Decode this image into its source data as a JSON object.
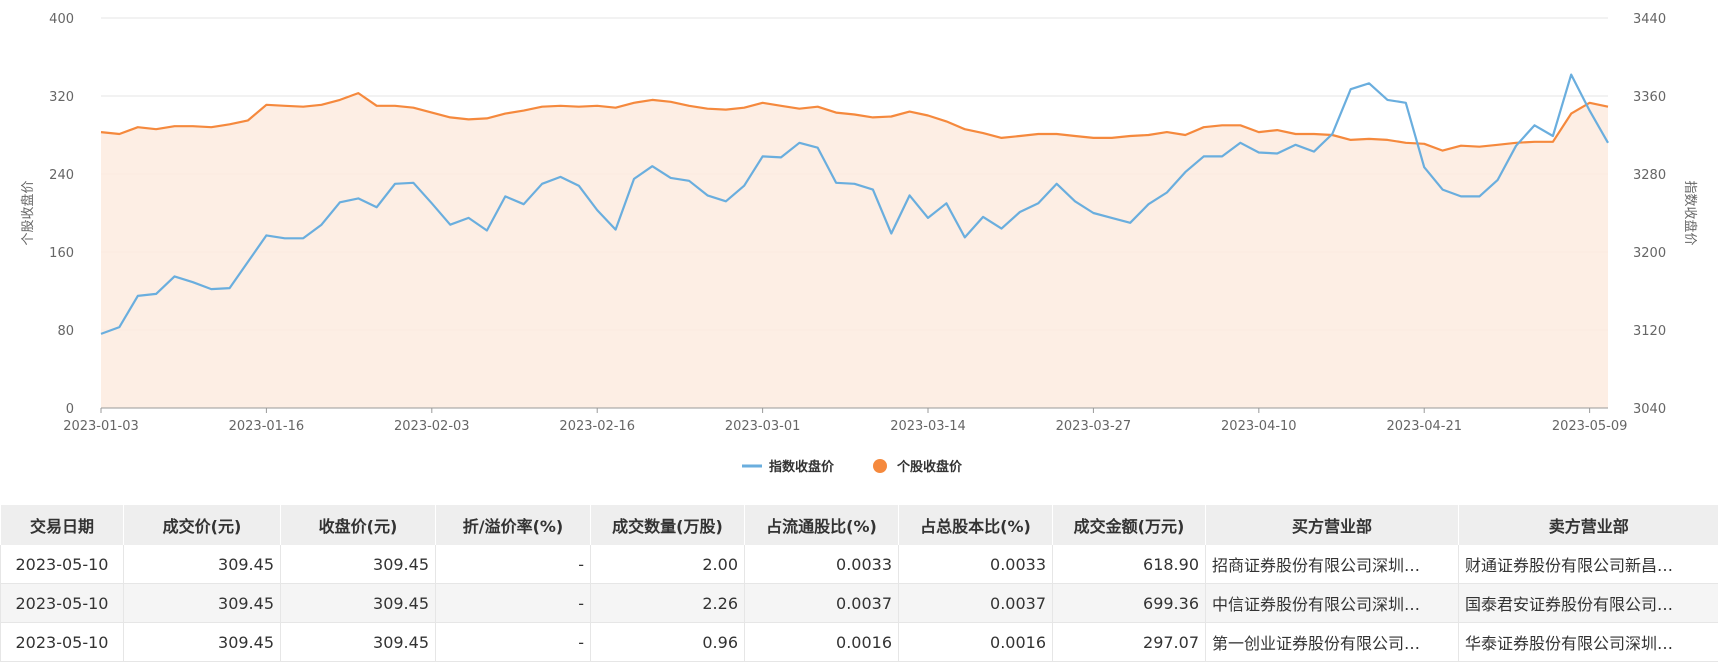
{
  "chart_data": {
    "type": "line",
    "x": [
      "2023-01-03",
      "2023-01-04",
      "2023-01-05",
      "2023-01-06",
      "2023-01-09",
      "2023-01-10",
      "2023-01-11",
      "2023-01-12",
      "2023-01-13",
      "2023-01-16",
      "2023-01-17",
      "2023-01-18",
      "2023-01-19",
      "2023-01-20",
      "2023-01-30",
      "2023-01-31",
      "2023-02-01",
      "2023-02-02",
      "2023-02-03",
      "2023-02-06",
      "2023-02-07",
      "2023-02-08",
      "2023-02-09",
      "2023-02-10",
      "2023-02-13",
      "2023-02-14",
      "2023-02-15",
      "2023-02-16",
      "2023-02-17",
      "2023-02-20",
      "2023-02-21",
      "2023-02-22",
      "2023-02-23",
      "2023-02-24",
      "2023-02-27",
      "2023-02-28",
      "2023-03-01",
      "2023-03-02",
      "2023-03-03",
      "2023-03-06",
      "2023-03-07",
      "2023-03-08",
      "2023-03-09",
      "2023-03-10",
      "2023-03-13",
      "2023-03-14",
      "2023-03-15",
      "2023-03-16",
      "2023-03-17",
      "2023-03-20",
      "2023-03-21",
      "2023-03-22",
      "2023-03-23",
      "2023-03-24",
      "2023-03-27",
      "2023-03-28",
      "2023-03-29",
      "2023-03-30",
      "2023-03-31",
      "2023-04-03",
      "2023-04-04",
      "2023-04-06",
      "2023-04-07",
      "2023-04-10",
      "2023-04-11",
      "2023-04-12",
      "2023-04-13",
      "2023-04-14",
      "2023-04-17",
      "2023-04-18",
      "2023-04-19",
      "2023-04-20",
      "2023-04-21",
      "2023-04-24",
      "2023-04-25",
      "2023-04-26",
      "2023-04-27",
      "2023-04-28",
      "2023-05-04",
      "2023-05-05",
      "2023-05-08",
      "2023-05-09",
      "2023-05-10"
    ],
    "x_ticks": [
      "2023-01-03",
      "2023-01-16",
      "2023-02-03",
      "2023-02-16",
      "2023-03-01",
      "2023-03-14",
      "2023-03-27",
      "2023-04-10",
      "2023-04-21",
      "2023-05-09"
    ],
    "series": [
      {
        "name": "指数收盘价",
        "axis": "right",
        "color": "#6aaede",
        "values": [
          3116,
          3123,
          3155,
          3157,
          3175,
          3169,
          3162,
          3163,
          3190,
          3217,
          3214,
          3214,
          3228,
          3251,
          3255,
          3246,
          3270,
          3271,
          3250,
          3228,
          3235,
          3222,
          3257,
          3249,
          3270,
          3277,
          3268,
          3243,
          3223,
          3275,
          3288,
          3276,
          3273,
          3258,
          3252,
          3268,
          3298,
          3297,
          3312,
          3307,
          3271,
          3270,
          3264,
          3219,
          3258,
          3235,
          3250,
          3215,
          3236,
          3224,
          3241,
          3250,
          3270,
          3252,
          3240,
          3235,
          3230,
          3249,
          3261,
          3282,
          3298,
          3298,
          3312,
          3302,
          3301,
          3310,
          3303,
          3321,
          3367,
          3373,
          3356,
          3353,
          3287,
          3264,
          3257,
          3257,
          3274,
          3309,
          3330,
          3319,
          3382,
          3345,
          3312
        ]
      },
      {
        "name": "个股收盘价",
        "axis": "left",
        "color": "#f5893d",
        "values": [
          283,
          281,
          288,
          286,
          289,
          289,
          288,
          291,
          295,
          311,
          310,
          309,
          311,
          316,
          323,
          310,
          310,
          308,
          303,
          298,
          296,
          297,
          302,
          305,
          309,
          310,
          309,
          310,
          308,
          313,
          316,
          314,
          310,
          307,
          306,
          308,
          313,
          310,
          307,
          309,
          303,
          301,
          298,
          299,
          304,
          300,
          294,
          286,
          282,
          277,
          279,
          281,
          281,
          279,
          277,
          277,
          279,
          280,
          283,
          280,
          288,
          290,
          290,
          283,
          285,
          281,
          281,
          280,
          275,
          276,
          275,
          272,
          271,
          264,
          269,
          268,
          270,
          272,
          273,
          273,
          302,
          313,
          309
        ]
      }
    ],
    "y_left": {
      "label": "个股收盘价",
      "ylim": [
        0,
        400
      ],
      "ticks": [
        0,
        80,
        160,
        240,
        320,
        400
      ]
    },
    "y_right": {
      "label": "指数收盘价",
      "ylim": [
        3040,
        3440
      ],
      "ticks": [
        3040,
        3120,
        3200,
        3280,
        3360,
        3440
      ]
    },
    "legend": {
      "placement": "bottom-center"
    },
    "grid": true
  },
  "table": {
    "headers": [
      "交易日期",
      "成交价(元)",
      "收盘价(元)",
      "折/溢价率(%)",
      "成交数量(万股)",
      "占流通股比(%)",
      "占总股本比(%)",
      "成交金额(万元)",
      "买方营业部",
      "卖方营业部"
    ],
    "rows": [
      [
        "2023-05-10",
        "309.45",
        "309.45",
        "-",
        "2.00",
        "0.0033",
        "0.0033",
        "618.90",
        "招商证券股份有限公司深圳…",
        "财通证券股份有限公司新昌…"
      ],
      [
        "2023-05-10",
        "309.45",
        "309.45",
        "-",
        "2.26",
        "0.0037",
        "0.0037",
        "699.36",
        "中信证券股份有限公司深圳…",
        "国泰君安证券股份有限公司…"
      ],
      [
        "2023-05-10",
        "309.45",
        "309.45",
        "-",
        "0.96",
        "0.0016",
        "0.0016",
        "297.07",
        "第一创业证券股份有限公司…",
        "华泰证券股份有限公司深圳…"
      ]
    ]
  }
}
